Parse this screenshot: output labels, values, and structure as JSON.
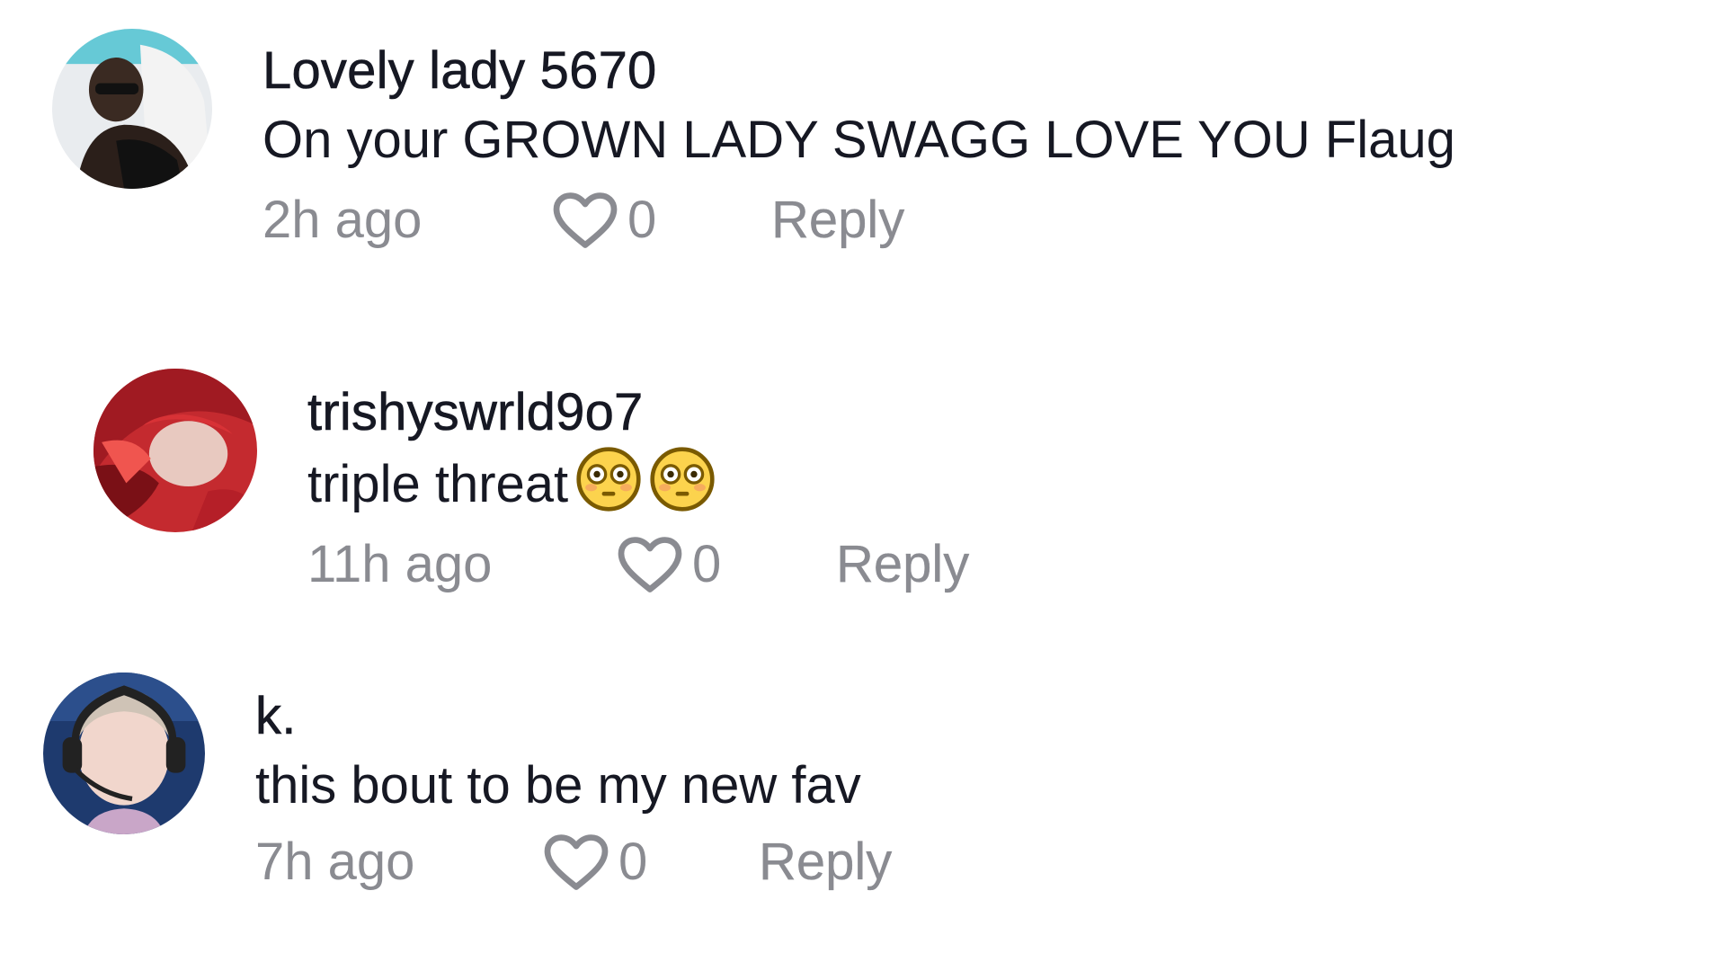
{
  "comments": [
    {
      "username": "Lovely lady 5670",
      "text": "On your GROWN LADY SWAGG LOVE YOU Flaug",
      "time": "2h ago",
      "likes": "0",
      "reply_label": "Reply"
    },
    {
      "username": "trishyswrld9o7",
      "text": "triple threat",
      "emojis": [
        "flushed-face",
        "flushed-face"
      ],
      "time": "11h ago",
      "likes": "0",
      "reply_label": "Reply"
    },
    {
      "username": "k.",
      "text": "this bout to be my new fav",
      "time": "7h ago",
      "likes": "0",
      "reply_label": "Reply"
    }
  ],
  "icons": {
    "like": "heart-outline-icon",
    "emoji": "flushed-face-emoji"
  },
  "colors": {
    "username": "#161823",
    "text": "#161823",
    "meta": "#8a8b91"
  }
}
